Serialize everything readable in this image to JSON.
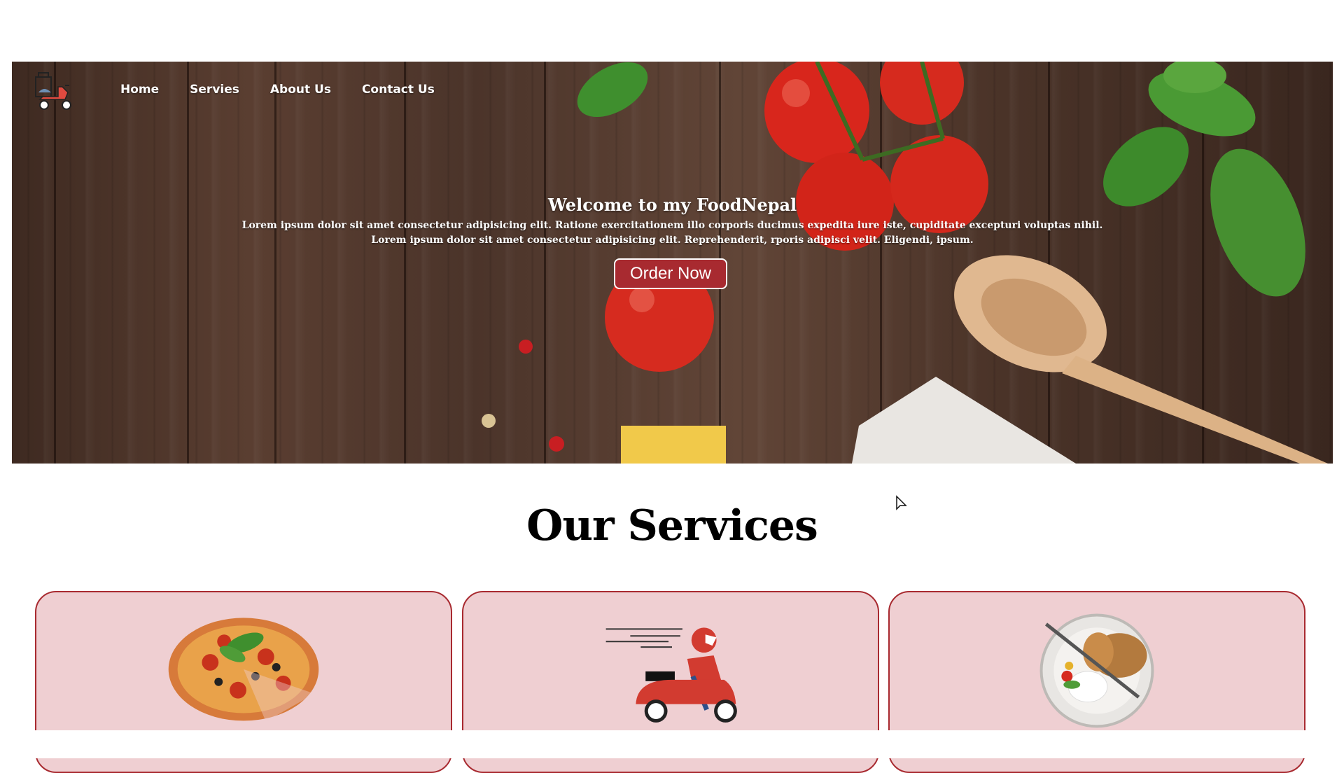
{
  "nav": {
    "items": [
      {
        "label": "Home"
      },
      {
        "label": "Servies"
      },
      {
        "label": "About Us"
      },
      {
        "label": "Contact Us"
      }
    ]
  },
  "hero": {
    "title": "Welcome to my FoodNepal",
    "line1": "Lorem ipsum dolor sit amet consectetur adipisicing elit. Ratione exercitationem illo corporis ducimus expedita iure iste, cupiditate excepturi voluptas nihil.",
    "line2": "Lorem ipsum dolor sit amet consectetur adipisicing elit. Reprehenderit, rporis adipisci velit. Eligendi, ipsum.",
    "button": "Order Now"
  },
  "services": {
    "title": "Our Services",
    "cards": [
      {
        "icon": "pizza-icon"
      },
      {
        "icon": "delivery-scooter-icon"
      },
      {
        "icon": "plated-meal-icon"
      }
    ]
  },
  "colors": {
    "accent": "#a82a30",
    "card_bg": "#efcfd2"
  }
}
